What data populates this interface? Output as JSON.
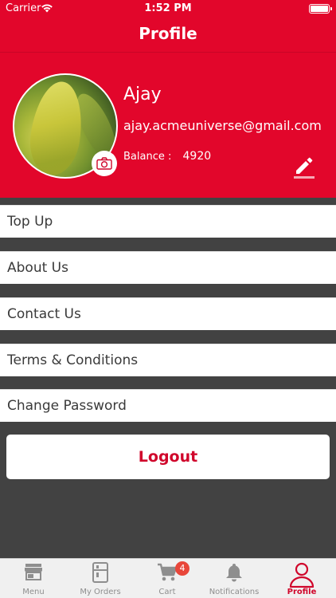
{
  "status_bar": {
    "carrier": "Carrier",
    "time": "1:52 PM"
  },
  "nav": {
    "title": "Profile"
  },
  "profile": {
    "name": "Ajay",
    "email": "ajay.acmeuniverse@gmail.com",
    "balance_label": "Balance :",
    "balance_value": "4920"
  },
  "menu": {
    "items": [
      {
        "label": "Top Up"
      },
      {
        "label": "About Us"
      },
      {
        "label": "Contact Us"
      },
      {
        "label": "Terms & Conditions"
      },
      {
        "label": "Change Password"
      }
    ]
  },
  "logout": {
    "label": "Logout"
  },
  "tabs": {
    "items": [
      {
        "label": "Menu",
        "icon": "store-icon"
      },
      {
        "label": "My Orders",
        "icon": "orders-icon"
      },
      {
        "label": "Cart",
        "icon": "cart-icon",
        "badge": "4"
      },
      {
        "label": "Notifications",
        "icon": "bell-icon"
      },
      {
        "label": "Profile",
        "icon": "person-icon"
      }
    ],
    "active": "Profile"
  },
  "colors": {
    "accent": "#e2062b",
    "background": "#424242",
    "tab_bar": "#f0f0f0",
    "badge": "#e8463a"
  }
}
